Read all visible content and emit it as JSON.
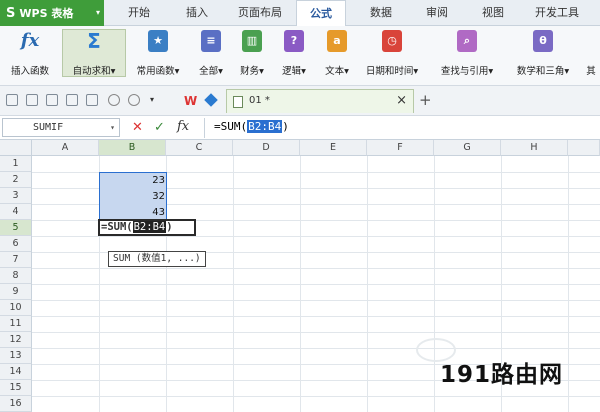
{
  "menubar": {
    "app_name": "WPS 表格",
    "tabs": [
      "开始",
      "插入",
      "页面布局",
      "公式",
      "数据",
      "审阅",
      "视图",
      "开发工具"
    ],
    "active_tab": "公式"
  },
  "ribbon": {
    "items": [
      {
        "label": "插入函数",
        "icon": "fx-icon"
      },
      {
        "label": "自动求和▾",
        "icon": "sigma-icon"
      },
      {
        "label": "常用函数▾",
        "icon": "star-icon",
        "color": "#3b7fc4"
      },
      {
        "label": "全部▾",
        "icon": "book-icon",
        "color": "#5a6fc4"
      },
      {
        "label": "财务▾",
        "icon": "finance-book-icon",
        "color": "#4aa050"
      },
      {
        "label": "逻辑▾",
        "icon": "logic-book-icon",
        "color": "#8a5ac4"
      },
      {
        "label": "文本▾",
        "icon": "text-book-icon",
        "color": "#e69a2a"
      },
      {
        "label": "日期和时间▾",
        "icon": "clock-book-icon",
        "color": "#d9443a"
      },
      {
        "label": "查找与引用▾",
        "icon": "search-book-icon",
        "color": "#b06ac4"
      },
      {
        "label": "数学和三角▾",
        "icon": "math-book-icon",
        "color": "#7a6ac4"
      },
      {
        "label": "其",
        "icon": "more-icon"
      }
    ]
  },
  "document": {
    "tab_name": "01 *",
    "close": "×",
    "new_tab": "+"
  },
  "formula_bar": {
    "name_box": "SUMIF",
    "formula_prefix": "=SUM(",
    "formula_range": "B2:B4",
    "formula_suffix": ")"
  },
  "grid": {
    "columns": [
      "A",
      "B",
      "C",
      "D",
      "E",
      "F",
      "G",
      "H"
    ],
    "rows": [
      "1",
      "2",
      "3",
      "4",
      "5",
      "6",
      "7",
      "8",
      "9",
      "10",
      "11",
      "12",
      "13",
      "14",
      "15",
      "16"
    ],
    "selected_column": "B",
    "selected_row": "5",
    "values": {
      "B2": "23",
      "B3": "32",
      "B4": "43"
    },
    "active_cell": {
      "prefix": "=SUM(",
      "range": "B2:B4",
      "suffix": ")"
    },
    "tooltip": "SUM (数值1, ...)"
  },
  "watermark": "191路由网"
}
